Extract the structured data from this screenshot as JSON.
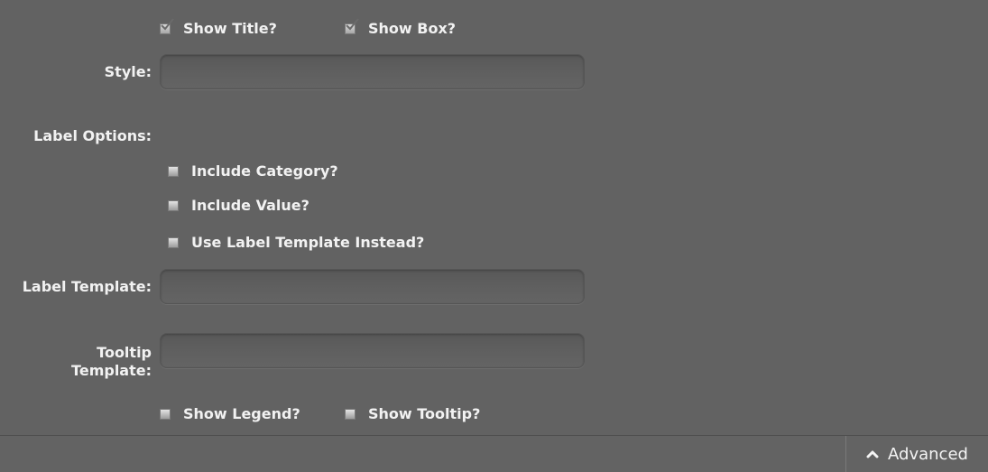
{
  "options": {
    "show_title": {
      "label": "Show Title?",
      "checked": true
    },
    "show_box": {
      "label": "Show Box?",
      "checked": true
    }
  },
  "style": {
    "label": "Style:",
    "value": ""
  },
  "label_options": {
    "heading": "Label Options:",
    "include_category": {
      "label": "Include Category?",
      "checked": false
    },
    "include_value": {
      "label": "Include Value?",
      "checked": false
    },
    "use_label_template": {
      "label": "Use Label Template Instead?",
      "checked": false
    }
  },
  "label_template": {
    "label": "Label Template:",
    "value": ""
  },
  "tooltip_template": {
    "label_line1": "Tooltip",
    "label_line2": "Template:",
    "value": ""
  },
  "bottom_options": {
    "show_legend": {
      "label": "Show Legend?",
      "checked": false
    },
    "show_tooltip": {
      "label": "Show Tooltip?",
      "checked": false
    }
  },
  "footer": {
    "advanced_label": "Advanced",
    "advanced_icon": "chevron-up-icon"
  },
  "colors": {
    "background": "#626262",
    "text": "#f2f2f2"
  }
}
